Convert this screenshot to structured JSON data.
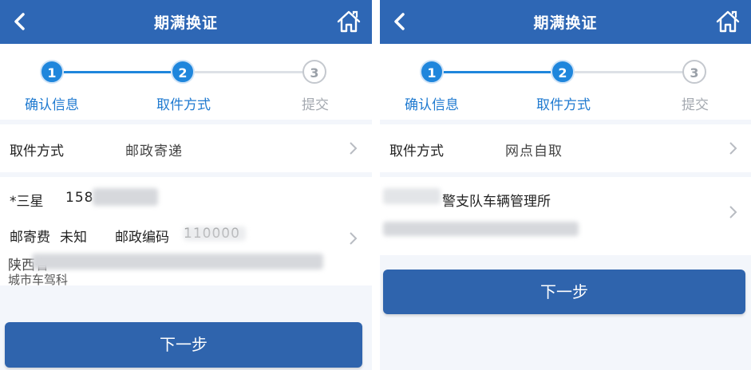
{
  "left": {
    "header": {
      "title": "期满换证"
    },
    "steps": [
      {
        "num": "1",
        "label": "确认信息"
      },
      {
        "num": "2",
        "label": "取件方式"
      },
      {
        "num": "3",
        "label": "提交"
      }
    ],
    "pickup": {
      "label": "取件方式",
      "value": "邮政寄递"
    },
    "contact": {
      "name": "*三星",
      "phone": "158"
    },
    "fee": {
      "label": "邮寄费",
      "value": "未知",
      "postcode_label": "邮政编码",
      "postcode_value": "110000"
    },
    "address": {
      "line1": "陕西省",
      "line2": "城市车驾科"
    },
    "next_button": "下一步"
  },
  "right": {
    "header": {
      "title": "期满换证"
    },
    "steps": [
      {
        "num": "1",
        "label": "确认信息"
      },
      {
        "num": "2",
        "label": "取件方式"
      },
      {
        "num": "3",
        "label": "提交"
      }
    ],
    "pickup": {
      "label": "取件方式",
      "value": "网点自取"
    },
    "office": {
      "name": "警支队车辆管理所"
    },
    "next_button": "下一步"
  },
  "colors": {
    "header": "#2e67b5",
    "accent": "#1f86dc",
    "button": "#2f64ad",
    "warning": "#d9363e"
  },
  "icons": {
    "back": "chevron-left-icon",
    "home": "home-icon",
    "row_arrow": "chevron-right-icon"
  }
}
